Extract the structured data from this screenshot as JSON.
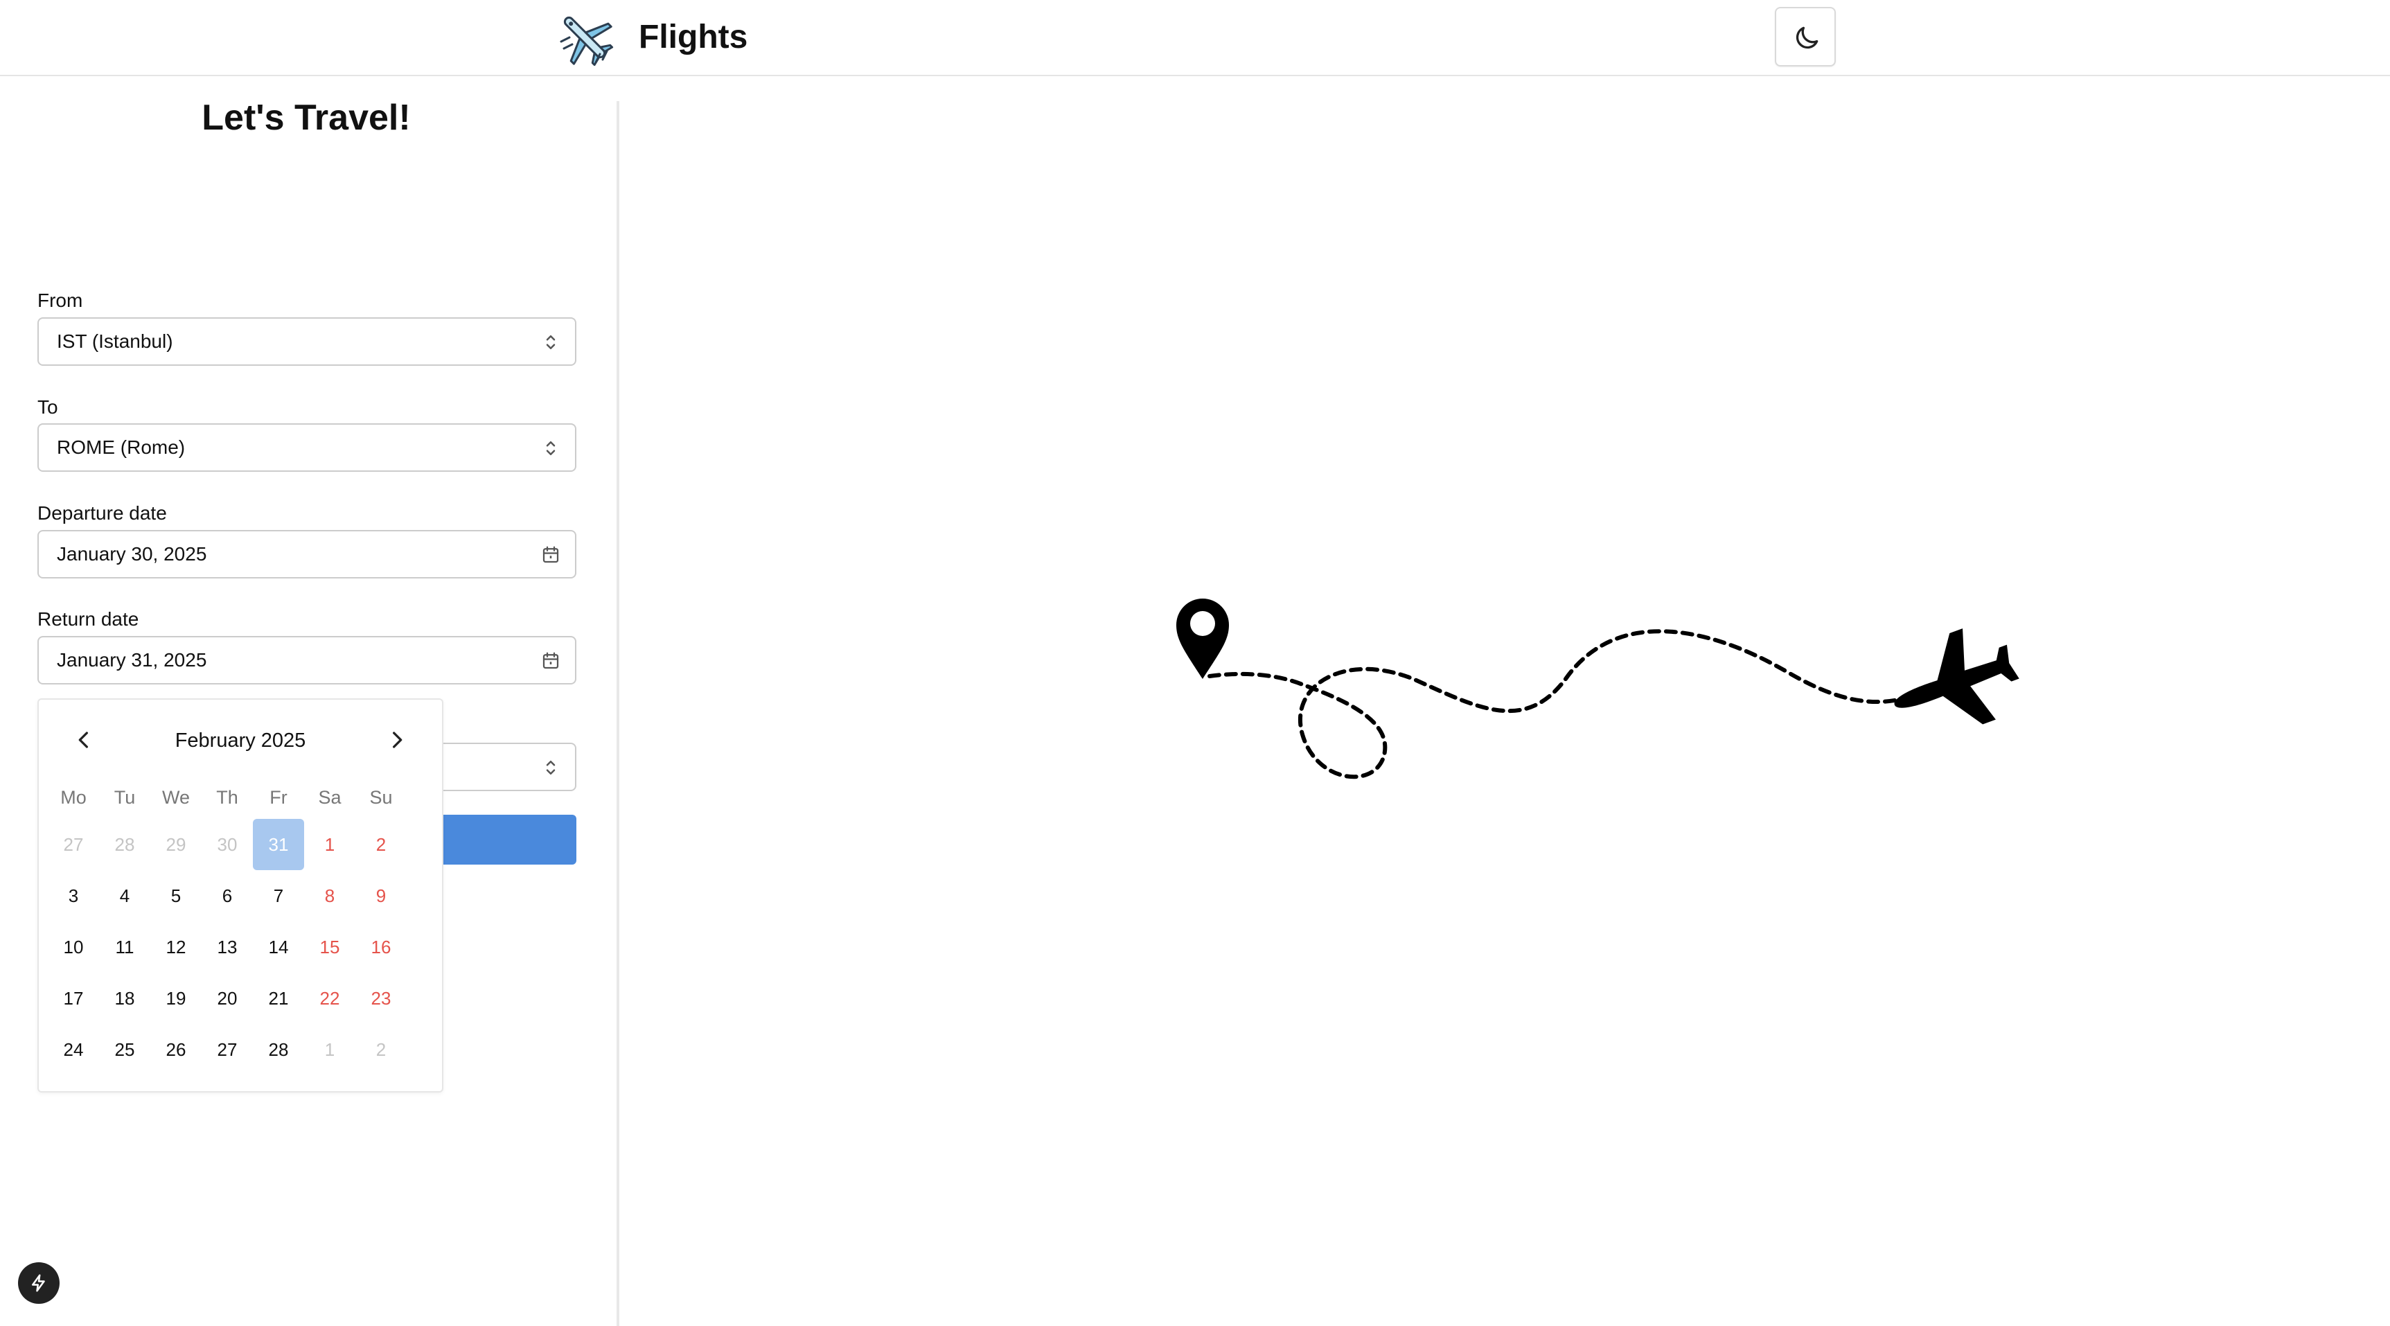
{
  "header": {
    "brand": "Flights",
    "logo_icon": "airplane-emoji-icon",
    "theme_toggle_icon": "moon-icon"
  },
  "form": {
    "title": "Let's Travel!",
    "from": {
      "label": "From",
      "value": "IST (Istanbul)",
      "icon": "chevron-up-down-icon"
    },
    "to": {
      "label": "To",
      "value": "ROME (Rome)",
      "icon": "chevron-up-down-icon"
    },
    "departure": {
      "label": "Departure date",
      "value": "January 30, 2025",
      "icon": "calendar-icon"
    },
    "return": {
      "label": "Return date",
      "value": "January 31, 2025",
      "icon": "calendar-icon"
    },
    "accent_color": "#4a89dc"
  },
  "calendar": {
    "month_label": "February 2025",
    "prev_icon": "chevron-left-icon",
    "next_icon": "chevron-right-icon",
    "weekdays": [
      "Mo",
      "Tu",
      "We",
      "Th",
      "Fr",
      "Sa",
      "Su"
    ],
    "weeks": [
      [
        {
          "d": "27",
          "outside": true
        },
        {
          "d": "28",
          "outside": true
        },
        {
          "d": "29",
          "outside": true
        },
        {
          "d": "30",
          "outside": true
        },
        {
          "d": "31",
          "outside": true,
          "selected": true
        },
        {
          "d": "1",
          "weekend": true
        },
        {
          "d": "2",
          "weekend": true
        }
      ],
      [
        {
          "d": "3"
        },
        {
          "d": "4"
        },
        {
          "d": "5"
        },
        {
          "d": "6"
        },
        {
          "d": "7"
        },
        {
          "d": "8",
          "weekend": true
        },
        {
          "d": "9",
          "weekend": true
        }
      ],
      [
        {
          "d": "10"
        },
        {
          "d": "11"
        },
        {
          "d": "12"
        },
        {
          "d": "13"
        },
        {
          "d": "14"
        },
        {
          "d": "15",
          "weekend": true
        },
        {
          "d": "16",
          "weekend": true
        }
      ],
      [
        {
          "d": "17"
        },
        {
          "d": "18"
        },
        {
          "d": "19"
        },
        {
          "d": "20"
        },
        {
          "d": "21"
        },
        {
          "d": "22",
          "weekend": true
        },
        {
          "d": "23",
          "weekend": true
        }
      ],
      [
        {
          "d": "24"
        },
        {
          "d": "25"
        },
        {
          "d": "26"
        },
        {
          "d": "27"
        },
        {
          "d": "28"
        },
        {
          "d": "1",
          "outside": true
        },
        {
          "d": "2",
          "outside": true
        }
      ]
    ],
    "weekend_color": "#e5534b",
    "selected_color": "#a8c8ef"
  },
  "illustration": {
    "start_icon": "map-pin-icon",
    "path": "dashed-flight-path",
    "end_icon": "airplane-icon"
  },
  "fab_icon": "lightning-icon"
}
